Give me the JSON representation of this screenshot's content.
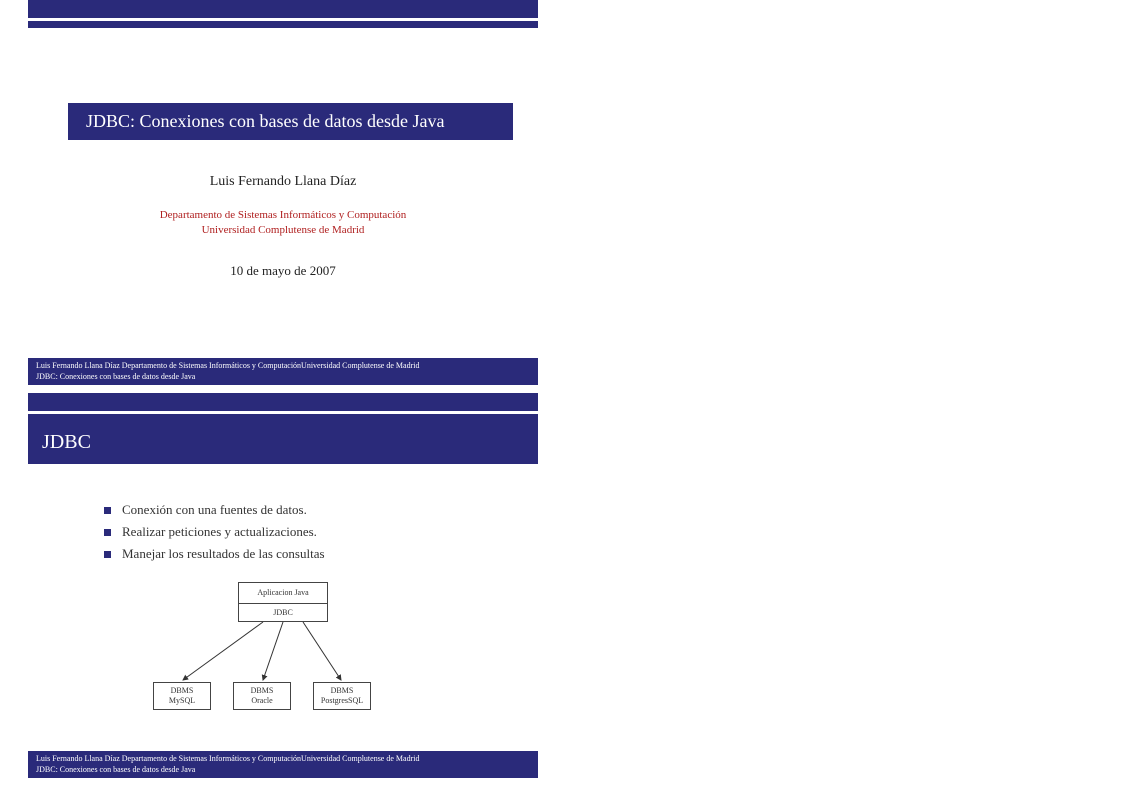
{
  "slide1": {
    "title": "JDBC: Conexiones con bases de datos desde Java",
    "author": "Luis Fernando Llana Díaz",
    "department_line1": "Departamento de Sistemas Informáticos y Computación",
    "department_line2": "Universidad Complutense de Madrid",
    "date": "10 de mayo de 2007",
    "footer_line1": "Luis Fernando Llana Díaz Departamento de Sistemas Informáticos y ComputaciónUniversidad Complutense de Madrid",
    "footer_line2": "JDBC: Conexiones con bases de datos desde Java"
  },
  "slide2": {
    "header": "JDBC",
    "bullets": [
      "Conexión con una fuentes de datos.",
      "Realizar peticiones y actualizaciones.",
      "Manejar los resultados de las consultas"
    ],
    "diagram": {
      "app": "Aplicacion Java",
      "jdbc": "JDBC",
      "db1_line1": "DBMS",
      "db1_line2": "MySQL",
      "db2_line1": "DBMS",
      "db2_line2": "Oracle",
      "db3_line1": "DBMS",
      "db3_line2": "PostgresSQL"
    },
    "footer_line1": "Luis Fernando Llana Díaz Departamento de Sistemas Informáticos y ComputaciónUniversidad Complutense de Madrid",
    "footer_line2": "JDBC: Conexiones con bases de datos desde Java"
  }
}
